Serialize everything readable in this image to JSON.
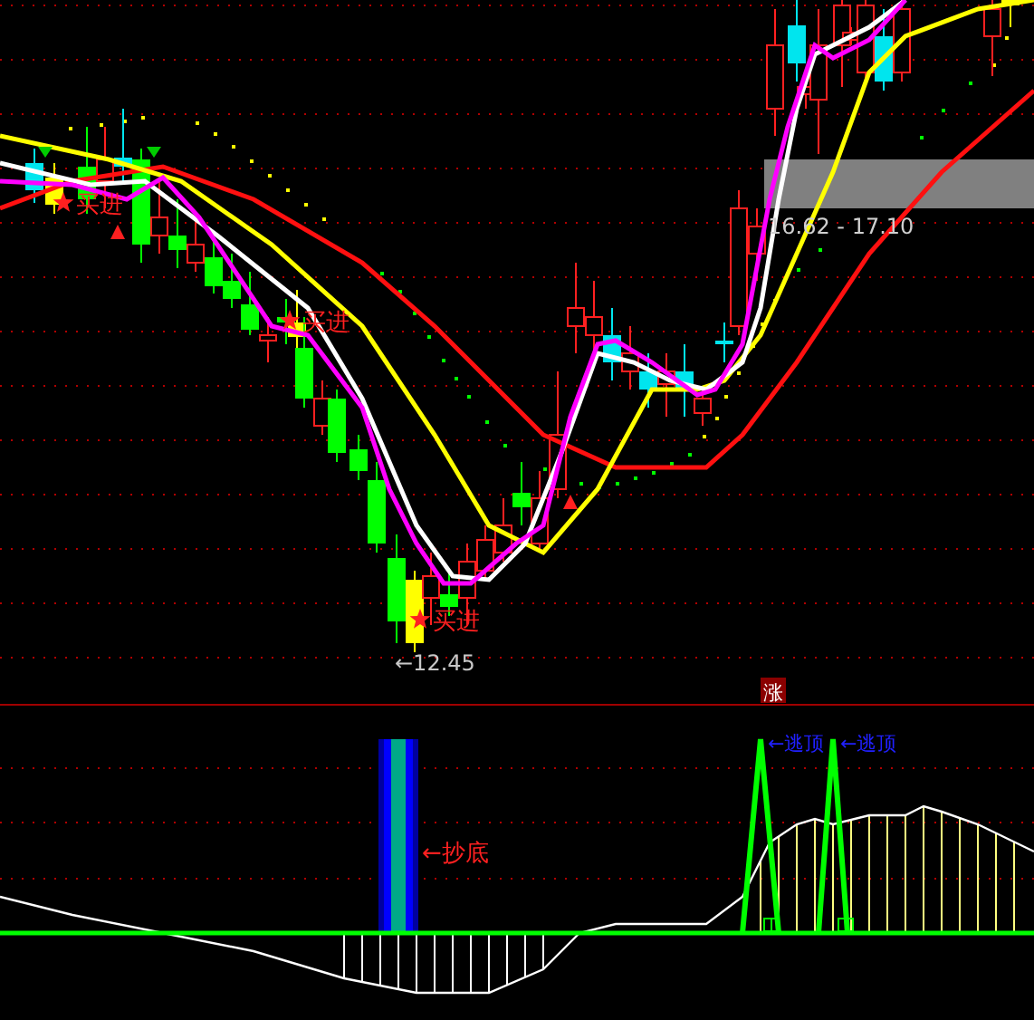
{
  "price_panel": {
    "signals": [
      {
        "kind": "buy",
        "label": "买进"
      },
      {
        "kind": "buy",
        "label": "买进"
      },
      {
        "kind": "buy",
        "label": "买进"
      }
    ],
    "low_marker": "←12.45",
    "range_label": "16.62 - 17.10"
  },
  "change_badge": "涨",
  "indicator_panel": {
    "bottom_signal": "←抄底",
    "top_signals": [
      "←逃顶",
      "←逃顶"
    ]
  }
}
